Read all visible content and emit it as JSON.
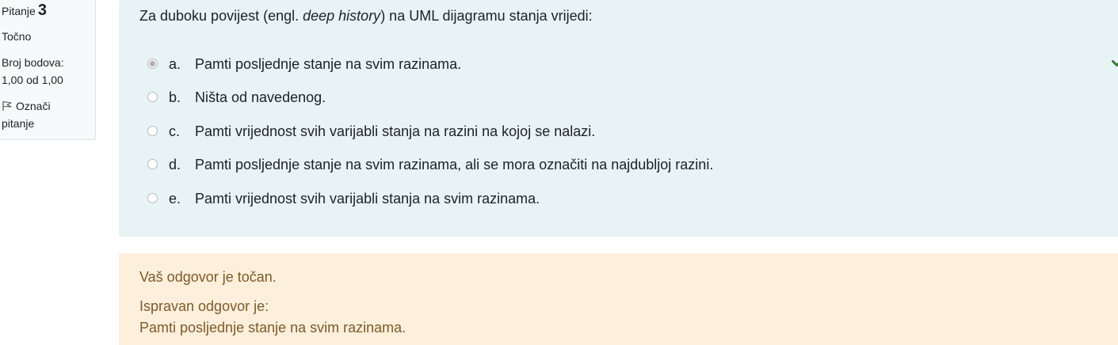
{
  "info": {
    "question_label": "Pitanje",
    "question_number": "3",
    "state": "Točno",
    "grade_label": "Broj bodova:",
    "grade_value": "1,00 od 1,00",
    "flag_label_line1": "Označi",
    "flag_label_line2": "pitanje"
  },
  "question": {
    "text_before": "Za duboku povijest (engl. ",
    "text_italic": "deep history",
    "text_after": ") na UML dijagramu stanja vrijedi:"
  },
  "answers": [
    {
      "letter": "a.",
      "text": "Pamti posljednje stanje na svim razinama.",
      "selected": true
    },
    {
      "letter": "b.",
      "text": "Ništa od navedenog.",
      "selected": false
    },
    {
      "letter": "c.",
      "text": "Pamti vrijednost svih varijabli stanja na razini na kojoj se nalazi.",
      "selected": false
    },
    {
      "letter": "d.",
      "text": "Pamti posljednje stanje na svim razinama, ali se mora označiti na najdubljoj razini.",
      "selected": false
    },
    {
      "letter": "e.",
      "text": "Pamti vrijednost svih varijabli stanja na svim razinama.",
      "selected": false
    }
  ],
  "outcome": {
    "feedback": "Vaš odgovor je točan.",
    "right_answer_label": "Ispravan odgovor je:",
    "right_answer_text": "Pamti posljednje stanje na svim razinama."
  },
  "icons": {
    "correct": "checkmark-icon",
    "flag": "flag-icon"
  },
  "colors": {
    "formulation_bg": "#e7f3f5",
    "outcome_bg": "#fcefdc",
    "outcome_text": "#7d5a29",
    "correct_check": "#357a32"
  }
}
